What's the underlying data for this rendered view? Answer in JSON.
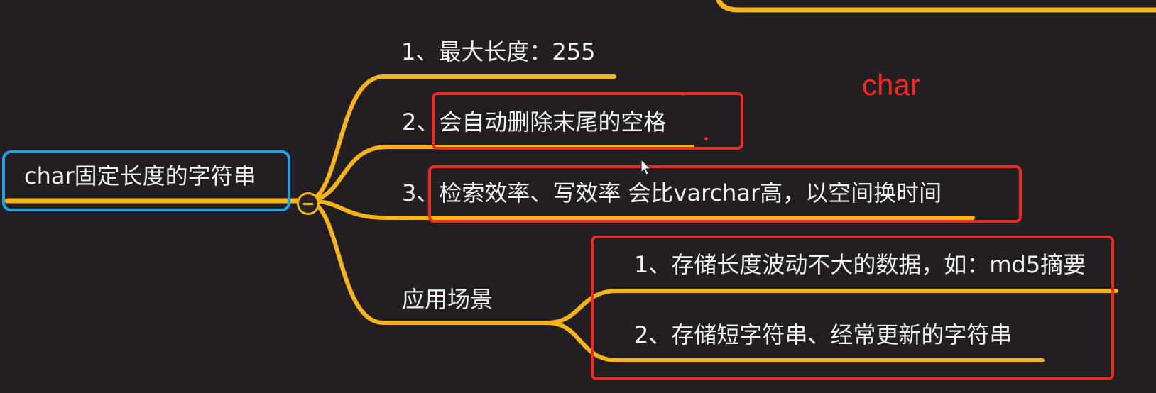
{
  "root": {
    "label": "char固定长度的字符串"
  },
  "branches": [
    {
      "label": "1、最大长度：255"
    },
    {
      "label": "2、会自动删除末尾的空格"
    },
    {
      "label": "3、检索效率、写效率 会比varchar高，以空间换时间"
    },
    {
      "label": "应用场景",
      "children": [
        {
          "label": "1、存储长度波动不大的数据，如：md5摘要"
        },
        {
          "label": "2、存储短字符串、经常更新的字符串"
        }
      ]
    }
  ],
  "annotation": {
    "text": "char"
  },
  "colors": {
    "background": "#221e22",
    "branch_line": "#f5b41c",
    "root_border": "#1fa2ea",
    "highlight_box": "#ee2a22",
    "annotation_text": "#ee2a22",
    "text": "#f2f2f2"
  }
}
